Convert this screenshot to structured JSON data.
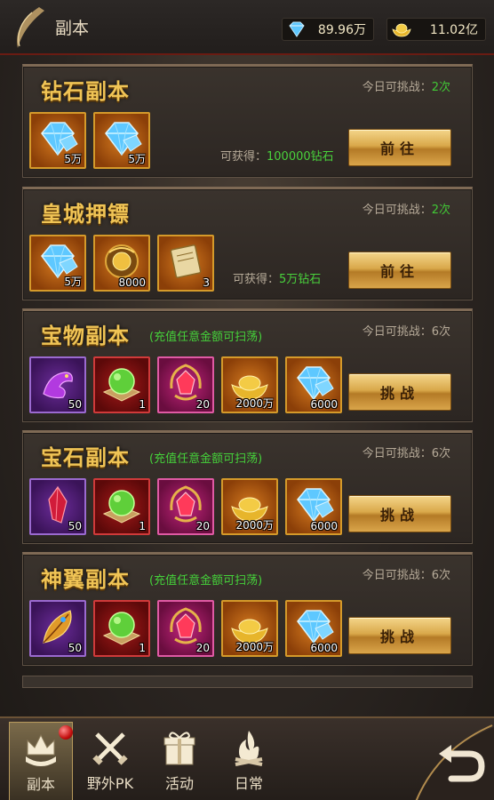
{
  "header": {
    "title": "副本",
    "diamonds": "89.96万",
    "gold": "11.02亿"
  },
  "cards": [
    {
      "title": "钻石副本",
      "note": "",
      "chances_label": "今日可挑战：",
      "chances_value": "2次",
      "chances_green": true,
      "items": [
        {
          "icon": "diamond-icon",
          "bg": "orange",
          "qty": "5万"
        },
        {
          "icon": "diamond-icon",
          "bg": "orange",
          "qty": "5万"
        }
      ],
      "gain_label": "可获得：",
      "gain_value": "100000钻石",
      "button": "前往"
    },
    {
      "title": "皇城押镖",
      "note": "",
      "chances_label": "今日可挑战：",
      "chances_value": "2次",
      "chances_green": true,
      "items": [
        {
          "icon": "diamond-icon",
          "bg": "orange",
          "qty": "5万"
        },
        {
          "icon": "gold-orb-icon",
          "bg": "orange",
          "qty": "8000"
        },
        {
          "icon": "scroll-icon",
          "bg": "orange",
          "qty": "3"
        }
      ],
      "gain_label": "可获得：",
      "gain_value": "5万钻石",
      "button": "前往"
    },
    {
      "title": "宝物副本",
      "note": "(充值任意金额可扫荡)",
      "chances_label": "今日可挑战：",
      "chances_value": "6次",
      "chances_green": false,
      "items": [
        {
          "icon": "purple-dragon-icon",
          "bg": "purple",
          "qty": "50"
        },
        {
          "icon": "green-orb-icon",
          "bg": "red",
          "qty": "1"
        },
        {
          "icon": "red-gem-icon",
          "bg": "pink",
          "qty": "20"
        },
        {
          "icon": "gold-ingot-icon",
          "bg": "orange",
          "qty": "2000万"
        },
        {
          "icon": "diamond-icon",
          "bg": "orange",
          "qty": "6000"
        }
      ],
      "gain_label": "",
      "gain_value": "",
      "button": "挑战"
    },
    {
      "title": "宝石副本",
      "note": "(充值任意金额可扫荡)",
      "chances_label": "今日可挑战：",
      "chances_value": "6次",
      "chances_green": false,
      "items": [
        {
          "icon": "red-crystal-icon",
          "bg": "purple",
          "qty": "50"
        },
        {
          "icon": "green-orb-icon",
          "bg": "red",
          "qty": "1"
        },
        {
          "icon": "red-gem-icon",
          "bg": "pink",
          "qty": "20"
        },
        {
          "icon": "gold-ingot-icon",
          "bg": "orange",
          "qty": "2000万"
        },
        {
          "icon": "diamond-icon",
          "bg": "orange",
          "qty": "6000"
        }
      ],
      "gain_label": "",
      "gain_value": "",
      "button": "挑战"
    },
    {
      "title": "神翼副本",
      "note": "(充值任意金额可扫荡)",
      "chances_label": "今日可挑战：",
      "chances_value": "6次",
      "chances_green": false,
      "items": [
        {
          "icon": "feather-icon",
          "bg": "purple",
          "qty": "50"
        },
        {
          "icon": "green-orb-icon",
          "bg": "red",
          "qty": "1"
        },
        {
          "icon": "red-gem-icon",
          "bg": "pink",
          "qty": "20"
        },
        {
          "icon": "gold-ingot-icon",
          "bg": "orange",
          "qty": "2000万"
        },
        {
          "icon": "diamond-icon",
          "bg": "orange",
          "qty": "6000"
        }
      ],
      "gain_label": "",
      "gain_value": "",
      "button": "挑战"
    }
  ],
  "nav": [
    {
      "label": "副本",
      "icon": "crown-icon",
      "active": true
    },
    {
      "label": "野外PK",
      "icon": "crossed-swords-icon",
      "active": false
    },
    {
      "label": "活动",
      "icon": "gift-box-icon",
      "active": false
    },
    {
      "label": "日常",
      "icon": "campfire-icon",
      "active": false
    }
  ]
}
